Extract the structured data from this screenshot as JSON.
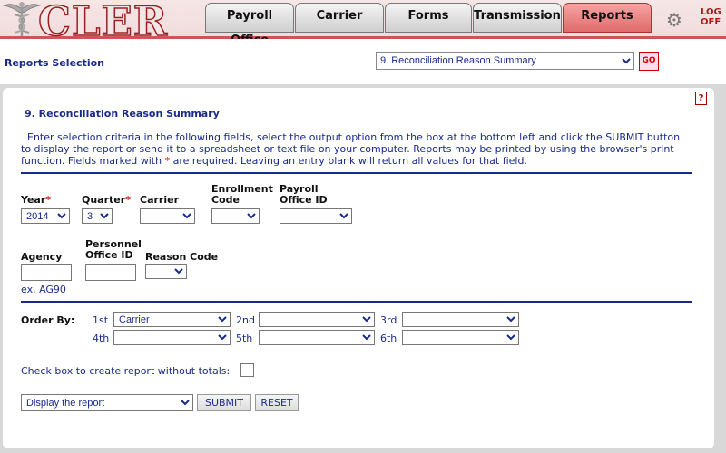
{
  "app": {
    "logo_text": "CLER",
    "tabs": [
      "Payroll Office",
      "Carrier",
      "Forms",
      "Transmission",
      "Reports"
    ],
    "active_tab": "Reports",
    "logoff_label": "LOG OFF"
  },
  "selection_bar": {
    "title": "Reports Selection",
    "report_selected": "9. Reconciliation Reason Summary",
    "go_label": "GO"
  },
  "report": {
    "help_label": "?",
    "title": "9. Reconciliation Reason Summary",
    "instructions_1": "Enter selection criteria in the following fields, select the output option from the box at the bottom left and click the SUBMIT button to display the report or send it to a spreadsheet or text file on your computer.  Reports may be printed by using the browser's print function.  Fields marked with ",
    "required_mark": "*",
    "instructions_2": " are required.  Leaving an entry blank will return all values for that field."
  },
  "fields": {
    "year": {
      "label": "Year",
      "value": "2014"
    },
    "quarter": {
      "label": "Quarter",
      "value": "3"
    },
    "carrier": {
      "label": "Carrier",
      "value": ""
    },
    "enrollment_code": {
      "label_1": "Enrollment",
      "label_2": "Code",
      "value": ""
    },
    "payroll_office_id": {
      "label_1": "Payroll",
      "label_2": "Office ID",
      "value": ""
    },
    "agency": {
      "label": "Agency",
      "value": "",
      "hint": "ex. AG90"
    },
    "personnel_office_id": {
      "label_1": "Personnel",
      "label_2": "Office ID",
      "value": ""
    },
    "reason_code": {
      "label": "Reason Code",
      "value": ""
    }
  },
  "order_by": {
    "label": "Order By:",
    "slots": [
      {
        "label": "1st",
        "value": "Carrier"
      },
      {
        "label": "2nd",
        "value": ""
      },
      {
        "label": "3rd",
        "value": ""
      },
      {
        "label": "4th",
        "value": ""
      },
      {
        "label": "5th",
        "value": ""
      },
      {
        "label": "6th",
        "value": ""
      }
    ]
  },
  "totals_checkbox": {
    "label": "Check box to create report without totals:",
    "checked": false
  },
  "output": {
    "selected": "Display the report",
    "submit_label": "SUBMIT",
    "reset_label": "RESET"
  }
}
